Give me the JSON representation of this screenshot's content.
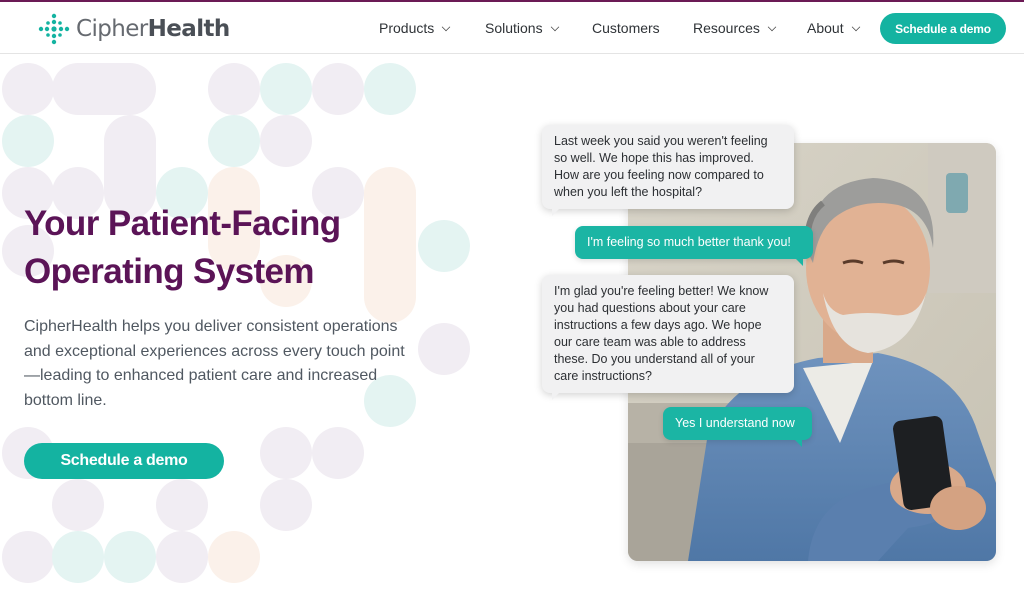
{
  "brand": {
    "name_light": "Cipher",
    "name_bold": "Health",
    "accent_color": "#14b3a1",
    "title_color": "#5b1457",
    "logo_icon": "cross-dots-logo"
  },
  "nav": {
    "items": [
      {
        "label": "Products",
        "dropdown": true
      },
      {
        "label": "Solutions",
        "dropdown": true
      },
      {
        "label": "Customers",
        "dropdown": false
      },
      {
        "label": "Resources",
        "dropdown": true
      },
      {
        "label": "About",
        "dropdown": true
      }
    ],
    "cta_label": "Schedule a demo"
  },
  "hero": {
    "title_line1": "Your Patient-Facing",
    "title_line2": "Operating System",
    "body": "CipherHealth helps you deliver consistent operations and exceptional experiences across every touch point—leading to enhanced patient care and increased bottom line.",
    "cta_label": "Schedule a demo"
  },
  "chat": {
    "messages": [
      {
        "from": "system",
        "text": "Last week you said you weren't feeling so well. We hope this has improved. How are you feeling now compared to when you left the hospital?"
      },
      {
        "from": "patient",
        "text": "I'm feeling so much better thank you!"
      },
      {
        "from": "system",
        "text": "I'm glad you're feeling better! We know you had questions about your care instructions a few days ago. We hope our care team was able to address these. Do you understand all of your care instructions?"
      },
      {
        "from": "patient",
        "text": "Yes I understand now"
      }
    ]
  }
}
